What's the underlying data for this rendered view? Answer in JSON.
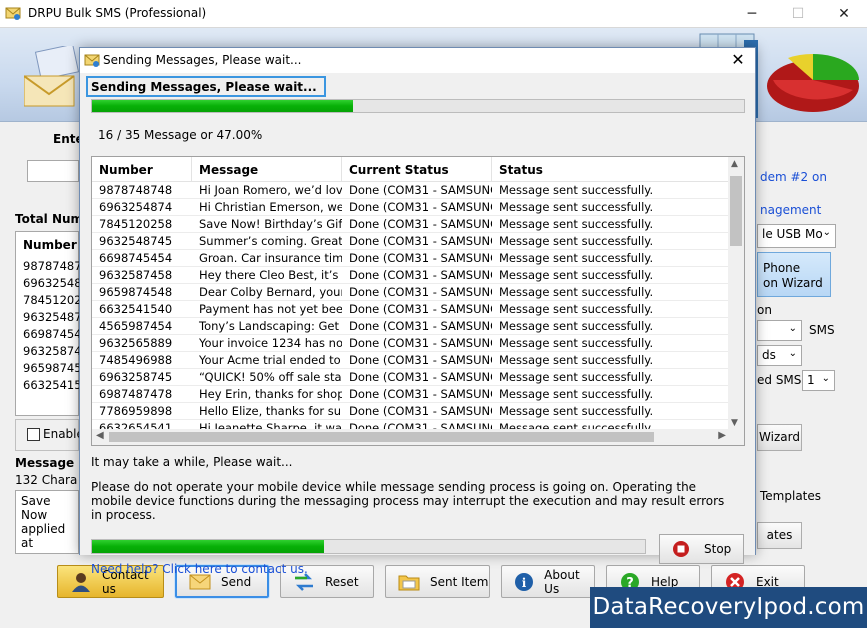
{
  "app": {
    "title": "DRPU Bulk SMS (Professional)",
    "window_buttons": {
      "minimize": "─",
      "maximize": "☐",
      "close": "✕"
    }
  },
  "background": {
    "enter_label": "Ente",
    "total_label": "Total Num",
    "number_header": "Number",
    "numbers": [
      "98787487",
      "69632548",
      "78451202",
      "96325487",
      "66987454",
      "96325874",
      "96598745",
      "66325415"
    ],
    "enable_label": "Enable",
    "message_label": "Message C",
    "chars_label": "132 Chara",
    "message_preview_1": "Save Now",
    "message_preview_2": "applied at",
    "modem_text": "dem #2 on",
    "management_text": "nagement",
    "usb_select": "le USB Mo",
    "phone_wizard_1": "Phone",
    "phone_wizard_2": "on Wizard",
    "on_text": "on",
    "sms_label": "SMS",
    "ds_select": "ds",
    "ed_sms_label": "ed SMS",
    "ed_sms_value": "1",
    "wizard_button": "Wizard",
    "templates_label": "Templates",
    "ates_button": "ates"
  },
  "bottom_buttons": [
    {
      "label": "Contact us",
      "icon": "contact-icon"
    },
    {
      "label": "Send",
      "icon": "envelope-icon"
    },
    {
      "label": "Reset",
      "icon": "reset-arrows-icon"
    },
    {
      "label": "Sent Item",
      "icon": "folder-icon"
    },
    {
      "label": "About Us",
      "icon": "info-icon"
    },
    {
      "label": "Help",
      "icon": "help-icon"
    },
    {
      "label": "Exit",
      "icon": "exit-icon"
    }
  ],
  "watermark": "DataRecoveryIpod.com",
  "dialog": {
    "title": "Sending Messages, Please wait...",
    "status_heading": "Sending Messages, Please wait...",
    "progress_top": 0.4,
    "count_text": "16 / 35 Message or 47.00%",
    "columns": [
      "Number",
      "Message",
      "Current Status",
      "Status"
    ],
    "rows": [
      [
        "9878748748",
        "Hi Joan Romero, we’d love",
        "Done (COM31 - SAMSUNG",
        "Message sent successfully."
      ],
      [
        "6963254874",
        "Hi Christian Emerson, we",
        "Done (COM31 - SAMSUNG",
        "Message sent successfully."
      ],
      [
        "7845120258",
        "Save Now! Birthday’s Gift",
        "Done (COM31 - SAMSUNG",
        "Message sent successfully."
      ],
      [
        "9632548745",
        "Summer’s coming. Great",
        "Done (COM31 - SAMSUNG",
        "Message sent successfully."
      ],
      [
        "6698745454",
        "Groan. Car insurance time",
        "Done (COM31 - SAMSUNG",
        "Message sent successfully."
      ],
      [
        "9632587458",
        "Hey there Cleo Best, it’s",
        "Done (COM31 - SAMSUNG",
        "Message sent successfully."
      ],
      [
        "9659874548",
        "Dear Colby Bernard, your",
        "Done (COM31 - SAMSUNG",
        "Message sent successfully."
      ],
      [
        "6632541540",
        "Payment has not yet been",
        "Done (COM31 - SAMSUNG",
        "Message sent successfully."
      ],
      [
        "4565987454",
        " Tony’s Landscaping: Get",
        "Done (COM31 - SAMSUNG",
        "Message sent successfully."
      ],
      [
        "9632565889",
        "Your invoice 1234 has not",
        "Done (COM31 - SAMSUNG",
        "Message sent successfully."
      ],
      [
        "7485496988",
        "Your Acme trial ended to",
        "Done (COM31 - SAMSUNG",
        "Message sent successfully."
      ],
      [
        "6963258745",
        "“QUICK! 50% off sale sta",
        "Done (COM31 - SAMSUNG",
        "Message sent successfully."
      ],
      [
        "6987487478",
        "Hey Erin, thanks for shop",
        "Done (COM31 - SAMSUNG",
        "Message sent successfully."
      ],
      [
        "7786959898",
        "Hello Elize, thanks for sub",
        "Done (COM31 - SAMSUNG",
        "Message sent successfully."
      ],
      [
        "6632654541",
        "Hi Jeanette Sharpe, it wa",
        "Done (COM31 - SAMSUNG",
        "Message sent successfully."
      ]
    ],
    "wait_text": "It may take a while, Please wait...",
    "warning_text": "Please do not operate your mobile device while message sending process is going on. Operating the mobile device functions during the messaging process may interrupt the execution and may result errors in process.",
    "progress_bottom": 0.42,
    "stop_label": "Stop",
    "help_link": "Need help? Click here to contact us."
  }
}
